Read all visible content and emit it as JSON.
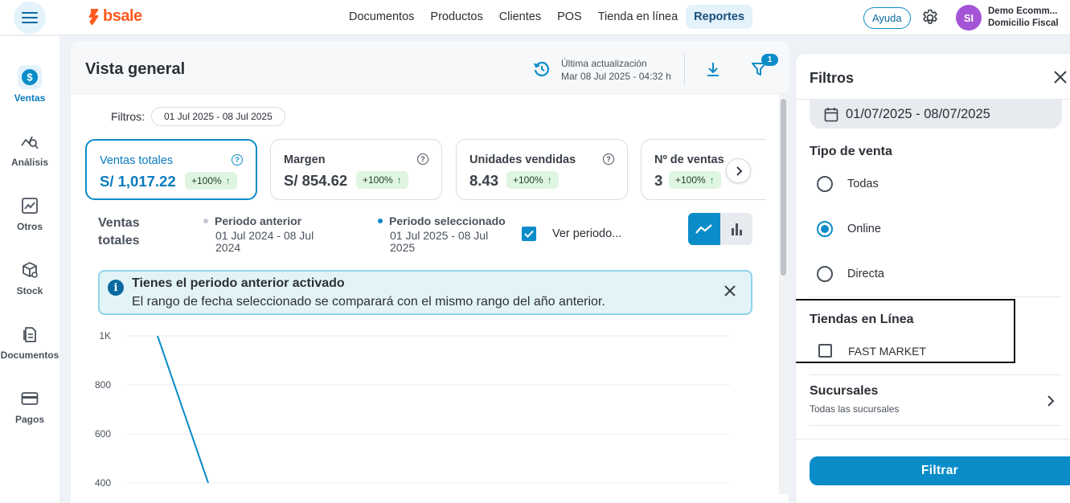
{
  "topbar": {
    "logo_text": "bsale",
    "nav": [
      "Documentos",
      "Productos",
      "Clientes",
      "POS",
      "Tienda en línea",
      "Reportes"
    ],
    "active_nav": "Reportes",
    "help_label": "Ayuda",
    "avatar_initials": "SI",
    "company_name": "Demo Ecomm...",
    "company_sub": "Domicilio Fiscal"
  },
  "sidebar": {
    "items": [
      {
        "label": "Ventas",
        "icon": "dollar-icon",
        "active": true
      },
      {
        "label": "Análisis",
        "icon": "analysis-icon",
        "active": false
      },
      {
        "label": "Otros",
        "icon": "trend-chart-icon",
        "active": false
      },
      {
        "label": "Stock",
        "icon": "box-icon",
        "active": false
      },
      {
        "label": "Documentos",
        "icon": "document-icon",
        "active": false
      },
      {
        "label": "Pagos",
        "icon": "card-icon",
        "active": false
      }
    ]
  },
  "main": {
    "title": "Vista general",
    "last_update_label": "Última actualización",
    "last_update_value": "Mar 08 Jul 2025 - 04:32 h",
    "filter_count": "1",
    "filters_label": "Filtros:",
    "filters_chip": "01 Jul 2025 - 08 Jul 2025",
    "kpis": [
      {
        "title": "Ventas totales",
        "value": "S/ 1,017.22",
        "badge": "+100%",
        "selected": true
      },
      {
        "title": "Margen",
        "value": "S/ 854.62",
        "badge": "+100%",
        "selected": false
      },
      {
        "title": "Unidades vendidas",
        "value": "8.43",
        "badge": "+100%",
        "selected": false
      },
      {
        "title": "Nº de ventas",
        "value": "3",
        "badge": "+100%",
        "selected": false
      }
    ],
    "chart_section_label": "Ventas totales",
    "legend": {
      "previous_title": "Periodo anterior",
      "previous_range": "01 Jul 2024 - 08 Jul 2024",
      "selected_title": "Periodo seleccionado",
      "selected_range": "01 Jul 2025 - 08 Jul 2025",
      "previous_color": "#c7c9d4",
      "selected_color": "#0a8cc9"
    },
    "ver_periodo_label": "Ver periodo...",
    "info_banner": {
      "title": "Tienes el periodo anterior activado",
      "text": "El rango de fecha seleccionado se comparará con el mismo rango del año anterior."
    }
  },
  "chart_data": {
    "type": "line",
    "y_ticks": [
      "1K",
      "800",
      "600",
      "400"
    ],
    "y_tick_values": [
      1000,
      800,
      600,
      400
    ],
    "series": [
      {
        "name": "Periodo seleccionado",
        "color": "#0a8cc9",
        "points": [
          [
            0,
            1000
          ],
          [
            1,
            400
          ]
        ]
      }
    ]
  },
  "filters_panel": {
    "title": "Filtros",
    "date_range": "01/07/2025 - 08/07/2025",
    "tipo_venta_title": "Tipo de venta",
    "tipo_venta_options": [
      {
        "label": "Todas",
        "selected": false
      },
      {
        "label": "Online",
        "selected": true
      },
      {
        "label": "Directa",
        "selected": false
      }
    ],
    "tiendas_title": "Tiendas en Línea",
    "tiendas_options": [
      {
        "label": "FAST MARKET",
        "checked": false
      }
    ],
    "sucursales_title": "Sucursales",
    "sucursales_sub": "Todas las sucursales",
    "submit_label": "Filtrar"
  }
}
